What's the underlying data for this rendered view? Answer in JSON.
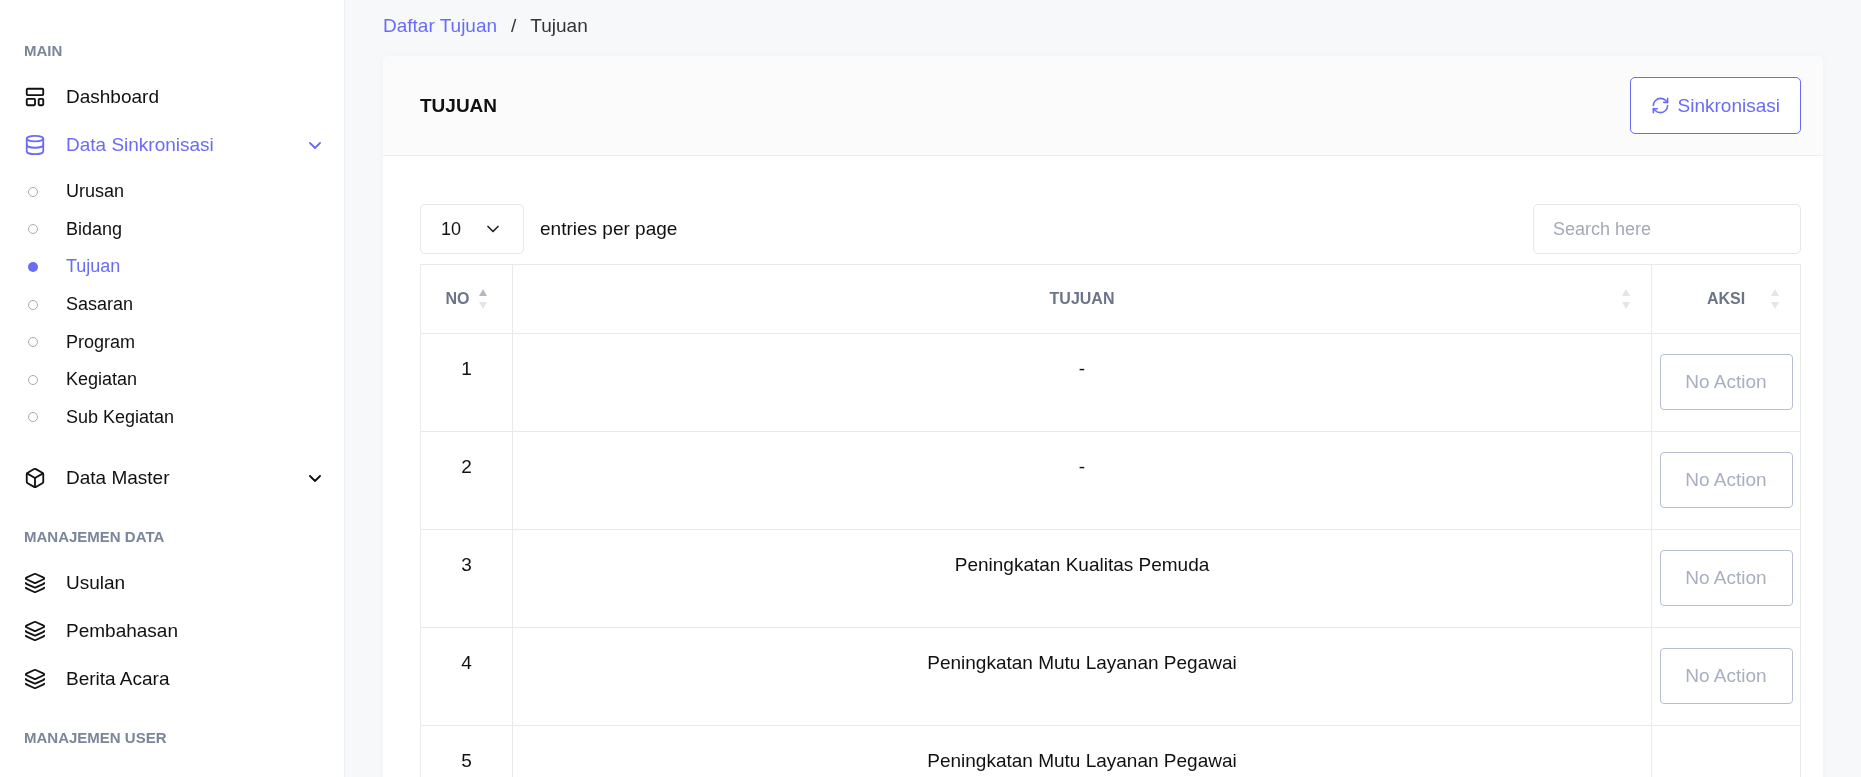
{
  "sidebar": {
    "sections": [
      {
        "heading": "MAIN",
        "items": [
          {
            "label": "Dashboard",
            "kind": "link",
            "selected": false
          },
          {
            "label": "Data Sinkronisasi",
            "kind": "group",
            "selected": true,
            "children": [
              {
                "label": "Urusan",
                "selected": false
              },
              {
                "label": "Bidang",
                "selected": false
              },
              {
                "label": "Tujuan",
                "selected": true
              },
              {
                "label": "Sasaran",
                "selected": false
              },
              {
                "label": "Program",
                "selected": false
              },
              {
                "label": "Kegiatan",
                "selected": false
              },
              {
                "label": "Sub Kegiatan",
                "selected": false
              }
            ]
          },
          {
            "label": "Data Master",
            "kind": "group",
            "selected": false
          }
        ]
      },
      {
        "heading": "MANAJEMEN DATA",
        "items": [
          {
            "label": "Usulan",
            "kind": "link",
            "selected": false
          },
          {
            "label": "Pembahasan",
            "kind": "link",
            "selected": false
          },
          {
            "label": "Berita Acara",
            "kind": "link",
            "selected": false
          }
        ]
      },
      {
        "heading": "MANAJEMEN USER"
      }
    ]
  },
  "breadcrumb": {
    "link": "Daftar Tujuan",
    "separator": "/",
    "current": "Tujuan"
  },
  "card": {
    "title": "TUJUAN",
    "sync_button": "Sinkronisasi"
  },
  "table_controls": {
    "per_page": "10",
    "per_page_label": "entries per page",
    "search": {
      "placeholder": "Search here"
    }
  },
  "table": {
    "columns": [
      "NO",
      "TUJUAN",
      "AKSI"
    ],
    "rows": [
      {
        "no": "1",
        "tujuan": "-",
        "action": "No Action"
      },
      {
        "no": "2",
        "tujuan": "-",
        "action": "No Action"
      },
      {
        "no": "3",
        "tujuan": "Peningkatan Kualitas Pemuda",
        "action": "No Action"
      },
      {
        "no": "4",
        "tujuan": "Peningkatan Mutu Layanan Pegawai",
        "action": "No Action"
      },
      {
        "no": "5",
        "tujuan": "Peningkatan Mutu Layanan Pegawai"
      }
    ]
  }
}
